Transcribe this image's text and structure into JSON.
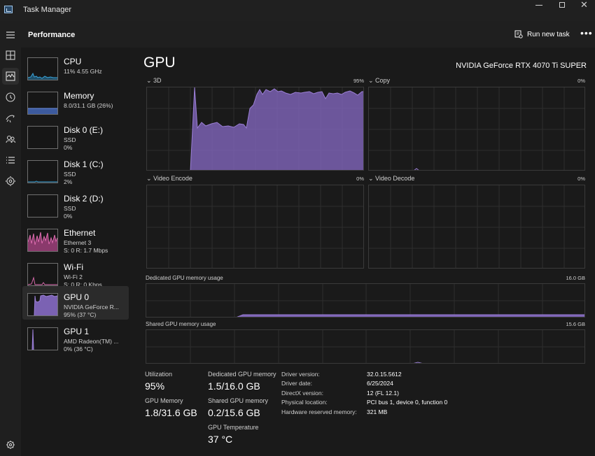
{
  "window": {
    "title": "Task Manager"
  },
  "header": {
    "page_title": "Performance",
    "run_task_label": "Run new task",
    "more_label": "•••"
  },
  "rail": {
    "icons": [
      "hamburger-icon",
      "processes-icon",
      "performance-icon",
      "app-history-icon",
      "startup-apps-icon",
      "users-icon",
      "details-icon",
      "services-icon",
      "settings-icon"
    ]
  },
  "devices": [
    {
      "name": "CPU",
      "sub1": "11% 4.55 GHz",
      "sub2": "",
      "color": "#3aa3d8",
      "fill": "#1f4f69"
    },
    {
      "name": "Memory",
      "sub1": "8.0/31.1 GB (26%)",
      "sub2": "",
      "color": "#6b8de3",
      "fill": "#3c5a9e"
    },
    {
      "name": "Disk 0 (E:)",
      "sub1": "SSD",
      "sub2": "0%",
      "color": "#6fbf3f",
      "fill": "#2f4f1d"
    },
    {
      "name": "Disk 1 (C:)",
      "sub1": "SSD",
      "sub2": "2%",
      "color": "#3aa3d8",
      "fill": "#1f4f69"
    },
    {
      "name": "Disk 2 (D:)",
      "sub1": "SSD",
      "sub2": "0%",
      "color": "#6fbf3f",
      "fill": "#2f4f1d"
    },
    {
      "name": "Ethernet",
      "sub1": "Ethernet 3",
      "sub2": "S: 0 R: 1.7 Mbps",
      "color": "#e36fb4",
      "fill": "#8a3a6c"
    },
    {
      "name": "Wi-Fi",
      "sub1": "Wi-Fi 2",
      "sub2": "S: 0 R: 0 Kbps",
      "color": "#e36fb4",
      "fill": "#8a3a6c"
    },
    {
      "name": "GPU 0",
      "sub1": "NVIDIA GeForce R...",
      "sub2": "95% (37 °C)",
      "color": "#9b7fd6",
      "fill": "#7b62b3"
    },
    {
      "name": "GPU 1",
      "sub1": "AMD Radeon(TM) ...",
      "sub2": "0% (36 °C)",
      "color": "#9b7fd6",
      "fill": "#7b62b3"
    }
  ],
  "gpu": {
    "title": "GPU",
    "model": "NVIDIA GeForce RTX 4070 Ti SUPER",
    "graphs": {
      "d3": {
        "label": "3D",
        "value": "95%"
      },
      "copy": {
        "label": "Copy",
        "value": "0%"
      },
      "video_encode": {
        "label": "Video Encode",
        "value": "0%"
      },
      "video_decode": {
        "label": "Video Decode",
        "value": "0%"
      },
      "dedicated": {
        "label": "Dedicated GPU memory usage",
        "value": "16.0 GB"
      },
      "shared": {
        "label": "Shared GPU memory usage",
        "value": "15.6 GB"
      }
    },
    "stats": {
      "utilization_label": "Utilization",
      "utilization_value": "95%",
      "dedicated_label": "Dedicated GPU memory",
      "dedicated_value": "1.5/16.0 GB",
      "gpu_memory_label": "GPU Memory",
      "gpu_memory_value": "1.8/31.6 GB",
      "shared_label": "Shared GPU memory",
      "shared_value": "0.2/15.6 GB",
      "temp_label": "GPU Temperature",
      "temp_value": "37 °C"
    },
    "info": [
      {
        "key": "Driver version:",
        "value": "32.0.15.5612"
      },
      {
        "key": "Driver date:",
        "value": "6/25/2024"
      },
      {
        "key": "DirectX version:",
        "value": "12 (FL 12.1)"
      },
      {
        "key": "Physical location:",
        "value": "PCI bus 1, device 0, function 0"
      },
      {
        "key": "Hardware reserved memory:",
        "value": "321 MB"
      }
    ]
  },
  "colors": {
    "accent_gpu": "#9b7fd6",
    "background": "#1a1a1a",
    "sidebar": "#191919"
  }
}
